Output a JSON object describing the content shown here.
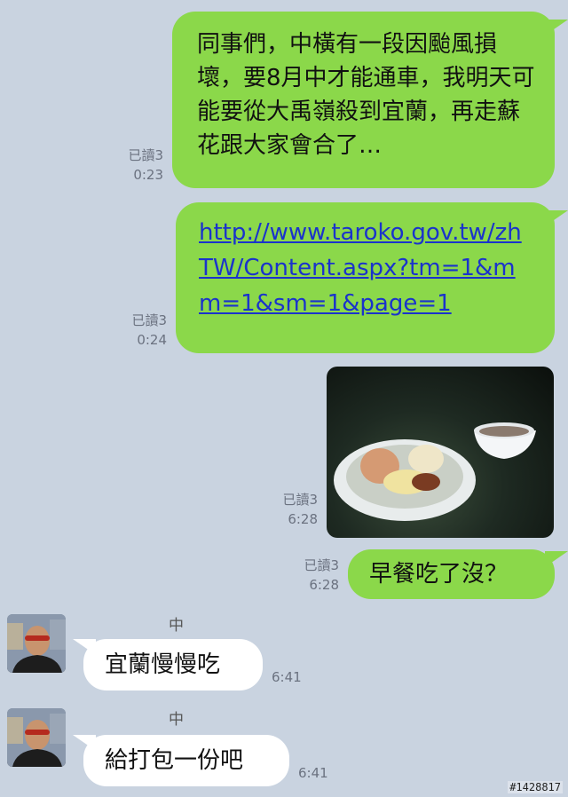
{
  "messages": [
    {
      "read": "已讀3",
      "time": "0:23",
      "text": "同事們，中橫有一段因颱風損壞，要8月中才能通車，我明天可能要從大禹嶺殺到宜蘭，再走蘇花跟大家會合了…"
    },
    {
      "read": "已讀3",
      "time": "0:24",
      "link": "http://www.taroko.gov.tw/zhTW/Content.aspx?tm=1&mm=1&sm=1&page=1"
    },
    {
      "read": "已讀3",
      "time": "6:28",
      "image": "breakfast-photo"
    },
    {
      "read": "已讀3",
      "time": "6:28",
      "text": "早餐吃了沒？"
    },
    {
      "sender": "中",
      "time": "6:41",
      "text": "宜蘭慢慢吃"
    },
    {
      "sender": "中",
      "time": "6:41",
      "text": "給打包一份吧"
    }
  ],
  "watermark": "#1428817",
  "colors": {
    "outgoing": "#8bd84a",
    "incoming": "#ffffff",
    "background": "#c9d3e0",
    "link": "#1a33cc"
  }
}
